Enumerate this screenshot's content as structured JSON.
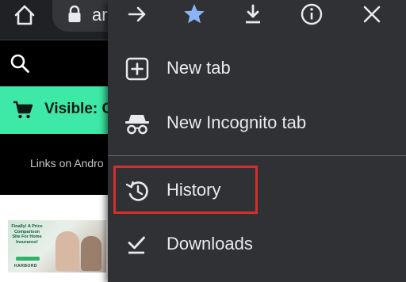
{
  "toolbar": {
    "url_partial": "ar"
  },
  "site": {
    "promo_text": "Visible: C",
    "subnav_text": "Links on Andro"
  },
  "ad": {
    "headline": "Finally! A Price Comparison Site For Home Insurance!",
    "logo": "HARBORD"
  },
  "menu": {
    "top_icons": [
      "forward-arrow-icon",
      "star-filled-icon",
      "download-icon",
      "info-icon",
      "close-icon"
    ],
    "items": [
      {
        "label": "New tab",
        "icon": "new-tab-icon"
      },
      {
        "label": "New Incognito tab",
        "icon": "incognito-icon"
      },
      {
        "label": "History",
        "icon": "history-icon"
      },
      {
        "label": "Downloads",
        "icon": "downloads-check-icon"
      }
    ]
  },
  "colors": {
    "menu_bg": "#303134",
    "star_blue": "#8ab4f8",
    "promo_green": "#3ee8a6",
    "highlight_red": "#d32f2f"
  }
}
